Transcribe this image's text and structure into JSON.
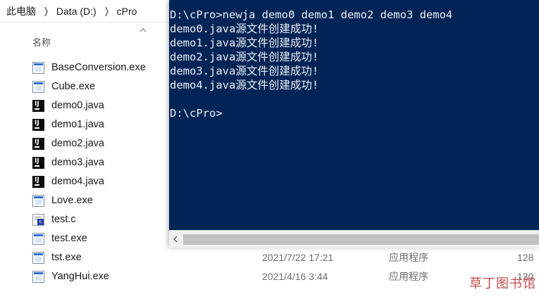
{
  "breadcrumb": {
    "items": [
      "此电脑",
      "Data (D:)",
      "cPro"
    ]
  },
  "columns": {
    "name": "名称"
  },
  "files": [
    {
      "name": "BaseConversion.exe",
      "icon": "exe-icon",
      "date": "",
      "type": "",
      "size": ""
    },
    {
      "name": "Cube.exe",
      "icon": "exe-icon",
      "date": "",
      "type": "",
      "size": ""
    },
    {
      "name": "demo0.java",
      "icon": "java-file-icon",
      "date": "",
      "type": "",
      "size": ""
    },
    {
      "name": "demo1.java",
      "icon": "java-file-icon",
      "date": "",
      "type": "",
      "size": ""
    },
    {
      "name": "demo2.java",
      "icon": "java-file-icon",
      "date": "",
      "type": "",
      "size": ""
    },
    {
      "name": "demo3.java",
      "icon": "java-file-icon",
      "date": "",
      "type": "",
      "size": ""
    },
    {
      "name": "demo4.java",
      "icon": "java-file-icon",
      "date": "",
      "type": "",
      "size": ""
    },
    {
      "name": "Love.exe",
      "icon": "exe-icon",
      "date": "",
      "type": "",
      "size": ""
    },
    {
      "name": "test.c",
      "icon": "c-file-icon",
      "date": "",
      "type": "",
      "size": ""
    },
    {
      "name": "test.exe",
      "icon": "exe-icon",
      "date": "",
      "type": "",
      "size": ""
    },
    {
      "name": "tst.exe",
      "icon": "exe-icon",
      "date": "2021/7/22 17:21",
      "type": "应用程序",
      "size": "128"
    },
    {
      "name": "YangHui.exe",
      "icon": "exe-icon",
      "date": "2021/4/16 3:44",
      "type": "应用程序",
      "size": "130"
    }
  ],
  "console": {
    "lines": [
      "D:\\cPro>newja demo0 demo1 demo2 demo3 demo4",
      "demo0.java源文件创建成功!",
      "demo1.java源文件创建成功!",
      "demo2.java源文件创建成功!",
      "demo3.java源文件创建成功!",
      "demo4.java源文件创建成功!",
      "",
      "D:\\cPro>"
    ],
    "background": "#012456",
    "foreground": "#eeedf0"
  },
  "watermark": "草丁图书馆"
}
